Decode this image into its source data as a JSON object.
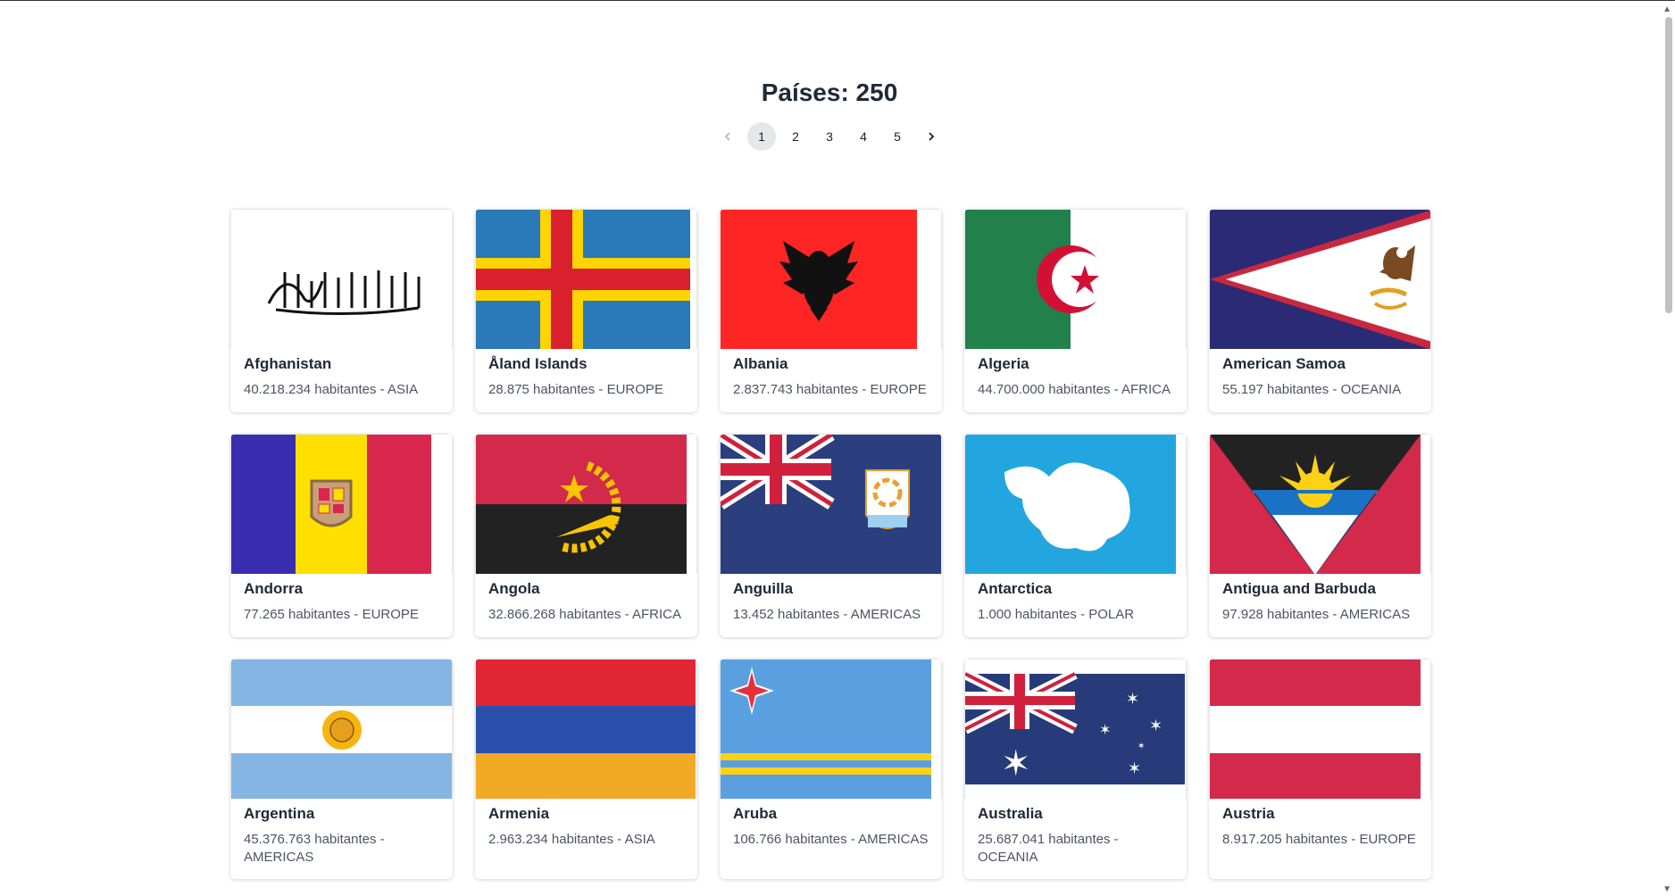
{
  "header": {
    "title": "Países: 250"
  },
  "pagination": {
    "prev_icon": "chevron-left-icon",
    "next_icon": "chevron-right-icon",
    "pages": [
      "1",
      "2",
      "3",
      "4",
      "5"
    ],
    "current": "1"
  },
  "countries": [
    {
      "name": "Afghanistan",
      "info": "40.218.234 habitantes - ASIA",
      "flag": "afghanistan-flag-icon"
    },
    {
      "name": "Åland Islands",
      "info": "28.875 habitantes - EUROPE",
      "flag": "aland-flag-icon"
    },
    {
      "name": "Albania",
      "info": "2.837.743 habitantes - EUROPE",
      "flag": "albania-flag-icon"
    },
    {
      "name": "Algeria",
      "info": "44.700.000 habitantes - AFRICA",
      "flag": "algeria-flag-icon"
    },
    {
      "name": "American Samoa",
      "info": "55.197 habitantes - OCEANIA",
      "flag": "american-samoa-flag-icon"
    },
    {
      "name": "Andorra",
      "info": "77.265 habitantes - EUROPE",
      "flag": "andorra-flag-icon"
    },
    {
      "name": "Angola",
      "info": "32.866.268 habitantes - AFRICA",
      "flag": "angola-flag-icon"
    },
    {
      "name": "Anguilla",
      "info": "13.452 habitantes - AMERICAS",
      "flag": "anguilla-flag-icon"
    },
    {
      "name": "Antarctica",
      "info": "1.000 habitantes - POLAR",
      "flag": "antarctica-flag-icon"
    },
    {
      "name": "Antigua and Barbuda",
      "info": "97.928 habitantes - AMERICAS",
      "flag": "antigua-flag-icon"
    },
    {
      "name": "Argentina",
      "info": "45.376.763 habitantes - AMERICAS",
      "flag": "argentina-flag-icon"
    },
    {
      "name": "Armenia",
      "info": "2.963.234 habitantes - ASIA",
      "flag": "armenia-flag-icon"
    },
    {
      "name": "Aruba",
      "info": "106.766 habitantes - AMERICAS",
      "flag": "aruba-flag-icon"
    },
    {
      "name": "Australia",
      "info": "25.687.041 habitantes - OCEANIA",
      "flag": "australia-flag-icon"
    },
    {
      "name": "Austria",
      "info": "8.917.205 habitantes - EUROPE",
      "flag": "austria-flag-icon"
    }
  ]
}
